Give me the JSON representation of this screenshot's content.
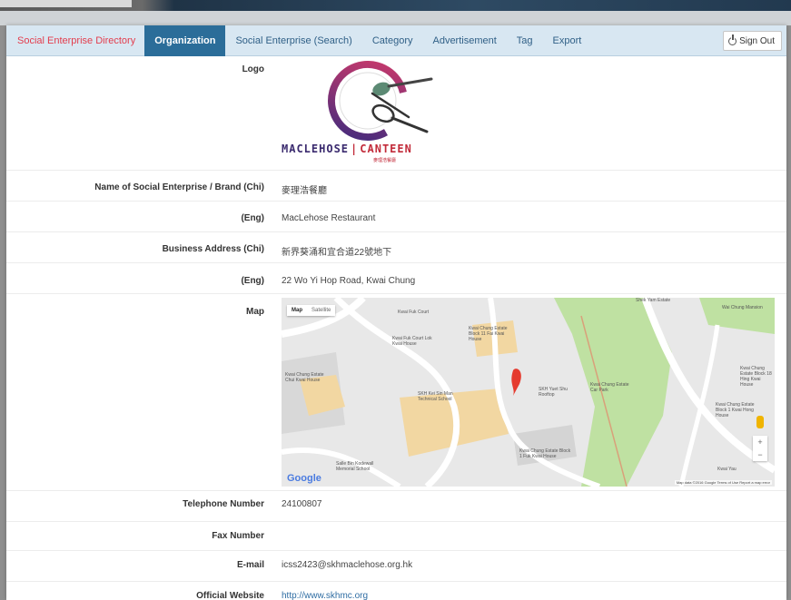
{
  "nav": {
    "brand": "Social Enterprise Directory",
    "items": [
      {
        "label": "Organization",
        "active": true
      },
      {
        "label": "Social Enterprise (Search)",
        "active": false
      },
      {
        "label": "Category",
        "active": false
      },
      {
        "label": "Advertisement",
        "active": false
      },
      {
        "label": "Tag",
        "active": false
      },
      {
        "label": "Export",
        "active": false
      }
    ],
    "signout_label": "Sign Out"
  },
  "colors": {
    "brand": "#e33d4d",
    "active_tab": "#2b6d99",
    "navbar_bg": "#d8e7f2",
    "link": "#2f6da3"
  },
  "fields": {
    "logo_label": "Logo",
    "name_chi_label": "Name of Social Enterprise / Brand (Chi)",
    "name_chi_value": "麥理浩餐廳",
    "name_eng_label": "(Eng)",
    "name_eng_value": "MacLehose Restaurant",
    "addr_chi_label": "Business Address (Chi)",
    "addr_chi_value": "新界葵涌和宜合道22號地下",
    "addr_eng_label": "(Eng)",
    "addr_eng_value": "22 Wo Yi Hop Road, Kwai Chung",
    "map_label": "Map",
    "tel_label": "Telephone Number",
    "tel_value": "24100807",
    "fax_label": "Fax Number",
    "fax_value": "",
    "email_label": "E-mail",
    "email_value": "icss2423@skhmaclehose.org.hk",
    "website_label": "Official Website",
    "website_value": "http://www.skhmc.org"
  },
  "logo": {
    "left_text": "MACLEHOSE",
    "right_text": "CANTEEN",
    "sub_text": "麥理浩餐廳"
  },
  "map": {
    "toggle_map": "Map",
    "toggle_satellite": "Satellite",
    "labels": [
      "Kwai Fuk Court",
      "Kwai Chung Estate Block 11 Fai Kwai House",
      "Kwai Fuk Court Lok Kwai House",
      "Kwai Chung Estate Chui Kwai House",
      "Kwai Chung Estate Car Park",
      "SKH Yuet Shu Rooftop",
      "Kwai Chung Estate Block 1 Fuk Kwai House",
      "Salle Bin Kodewall Memorial School",
      "SKH Kei Sin Man Technical School",
      "Shek Yam Estate",
      "Wai Chung Mansion",
      "Kwai Chung Estate Block 18 Hing Kwai House",
      "Kwai Chung Estate Block 1 Kwai Hong House",
      "Kwai Yau"
    ],
    "brand": "Google",
    "attribution": "Map data ©2016 Google   Terms of Use   Report a map error"
  }
}
